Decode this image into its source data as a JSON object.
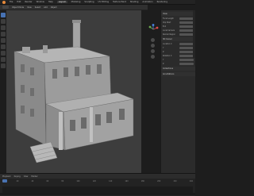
{
  "app": {
    "logo_icon": "blender-logo-icon"
  },
  "menu": {
    "items": [
      "File",
      "Edit",
      "Render",
      "Window",
      "Help",
      "Layout",
      "Modeling",
      "Sculpting",
      "UV Editing",
      "Texture Paint",
      "Shading",
      "Animation",
      "Rendering",
      "Compositing",
      "Geometry Nodes",
      "Scripting"
    ],
    "active_index": 5
  },
  "viewport_header": {
    "mode_label": "Object Mode",
    "view_label": "View",
    "select_label": "Select",
    "add_label": "Add",
    "object_label": "Object"
  },
  "toolbar": {
    "tools": [
      "select-icon",
      "cursor-icon",
      "move-icon",
      "rotate-icon",
      "scale-icon",
      "transform-icon",
      "annotate-icon",
      "measure-icon",
      "add-cube-icon"
    ],
    "active_index": 0
  },
  "npanel": {
    "sections": [
      {
        "title": "View",
        "rows": [
          "Focal Length",
          "Clip Start",
          "End",
          "Local Camera",
          "Render Region"
        ]
      },
      {
        "title": "3D Cursor",
        "rows": [
          "Location X",
          "Y",
          "Z",
          "Rotation X",
          "Y",
          "Z"
        ]
      },
      {
        "title": "Collections",
        "rows": []
      },
      {
        "title": "Annotations",
        "rows": []
      }
    ]
  },
  "timeline": {
    "header": [
      "Playback",
      "Keying",
      "View",
      "Marker"
    ],
    "ruler": [
      "0",
      "20",
      "40",
      "60",
      "80",
      "100",
      "120",
      "140",
      "160",
      "180",
      "200",
      "220",
      "240"
    ]
  },
  "colors": {
    "accent": "#4772b3",
    "viewport_bg": "#3d3d3d",
    "building": "#9a9a9a",
    "logo": "#e78a3a"
  }
}
